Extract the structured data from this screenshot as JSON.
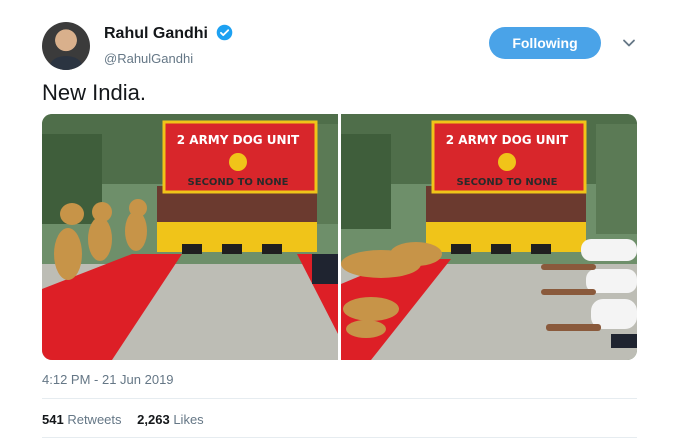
{
  "author": {
    "display_name": "Rahul Gandhi",
    "handle": "@RahulGandhi",
    "verified": true,
    "verified_color": "#1da1f2"
  },
  "follow_button": {
    "label": "Following",
    "color": "#4aa3e8"
  },
  "tweet": {
    "text": "New India."
  },
  "media": {
    "left_photo": {
      "sign_line1": "2 ARMY DOG UNIT",
      "sign_line2": "SECOND TO NONE"
    },
    "right_photo": {
      "sign_line1": "2 ARMY DOG UNIT",
      "sign_line2": "SECOND TO NONE"
    }
  },
  "timestamp": "4:12 PM - 21 Jun 2019",
  "stats": {
    "retweets_count": "541",
    "retweets_label": "Retweets",
    "likes_count": "2,263",
    "likes_label": "Likes"
  },
  "icons": {
    "verified": "verified-badge-icon",
    "menu": "chevron-down-icon"
  }
}
